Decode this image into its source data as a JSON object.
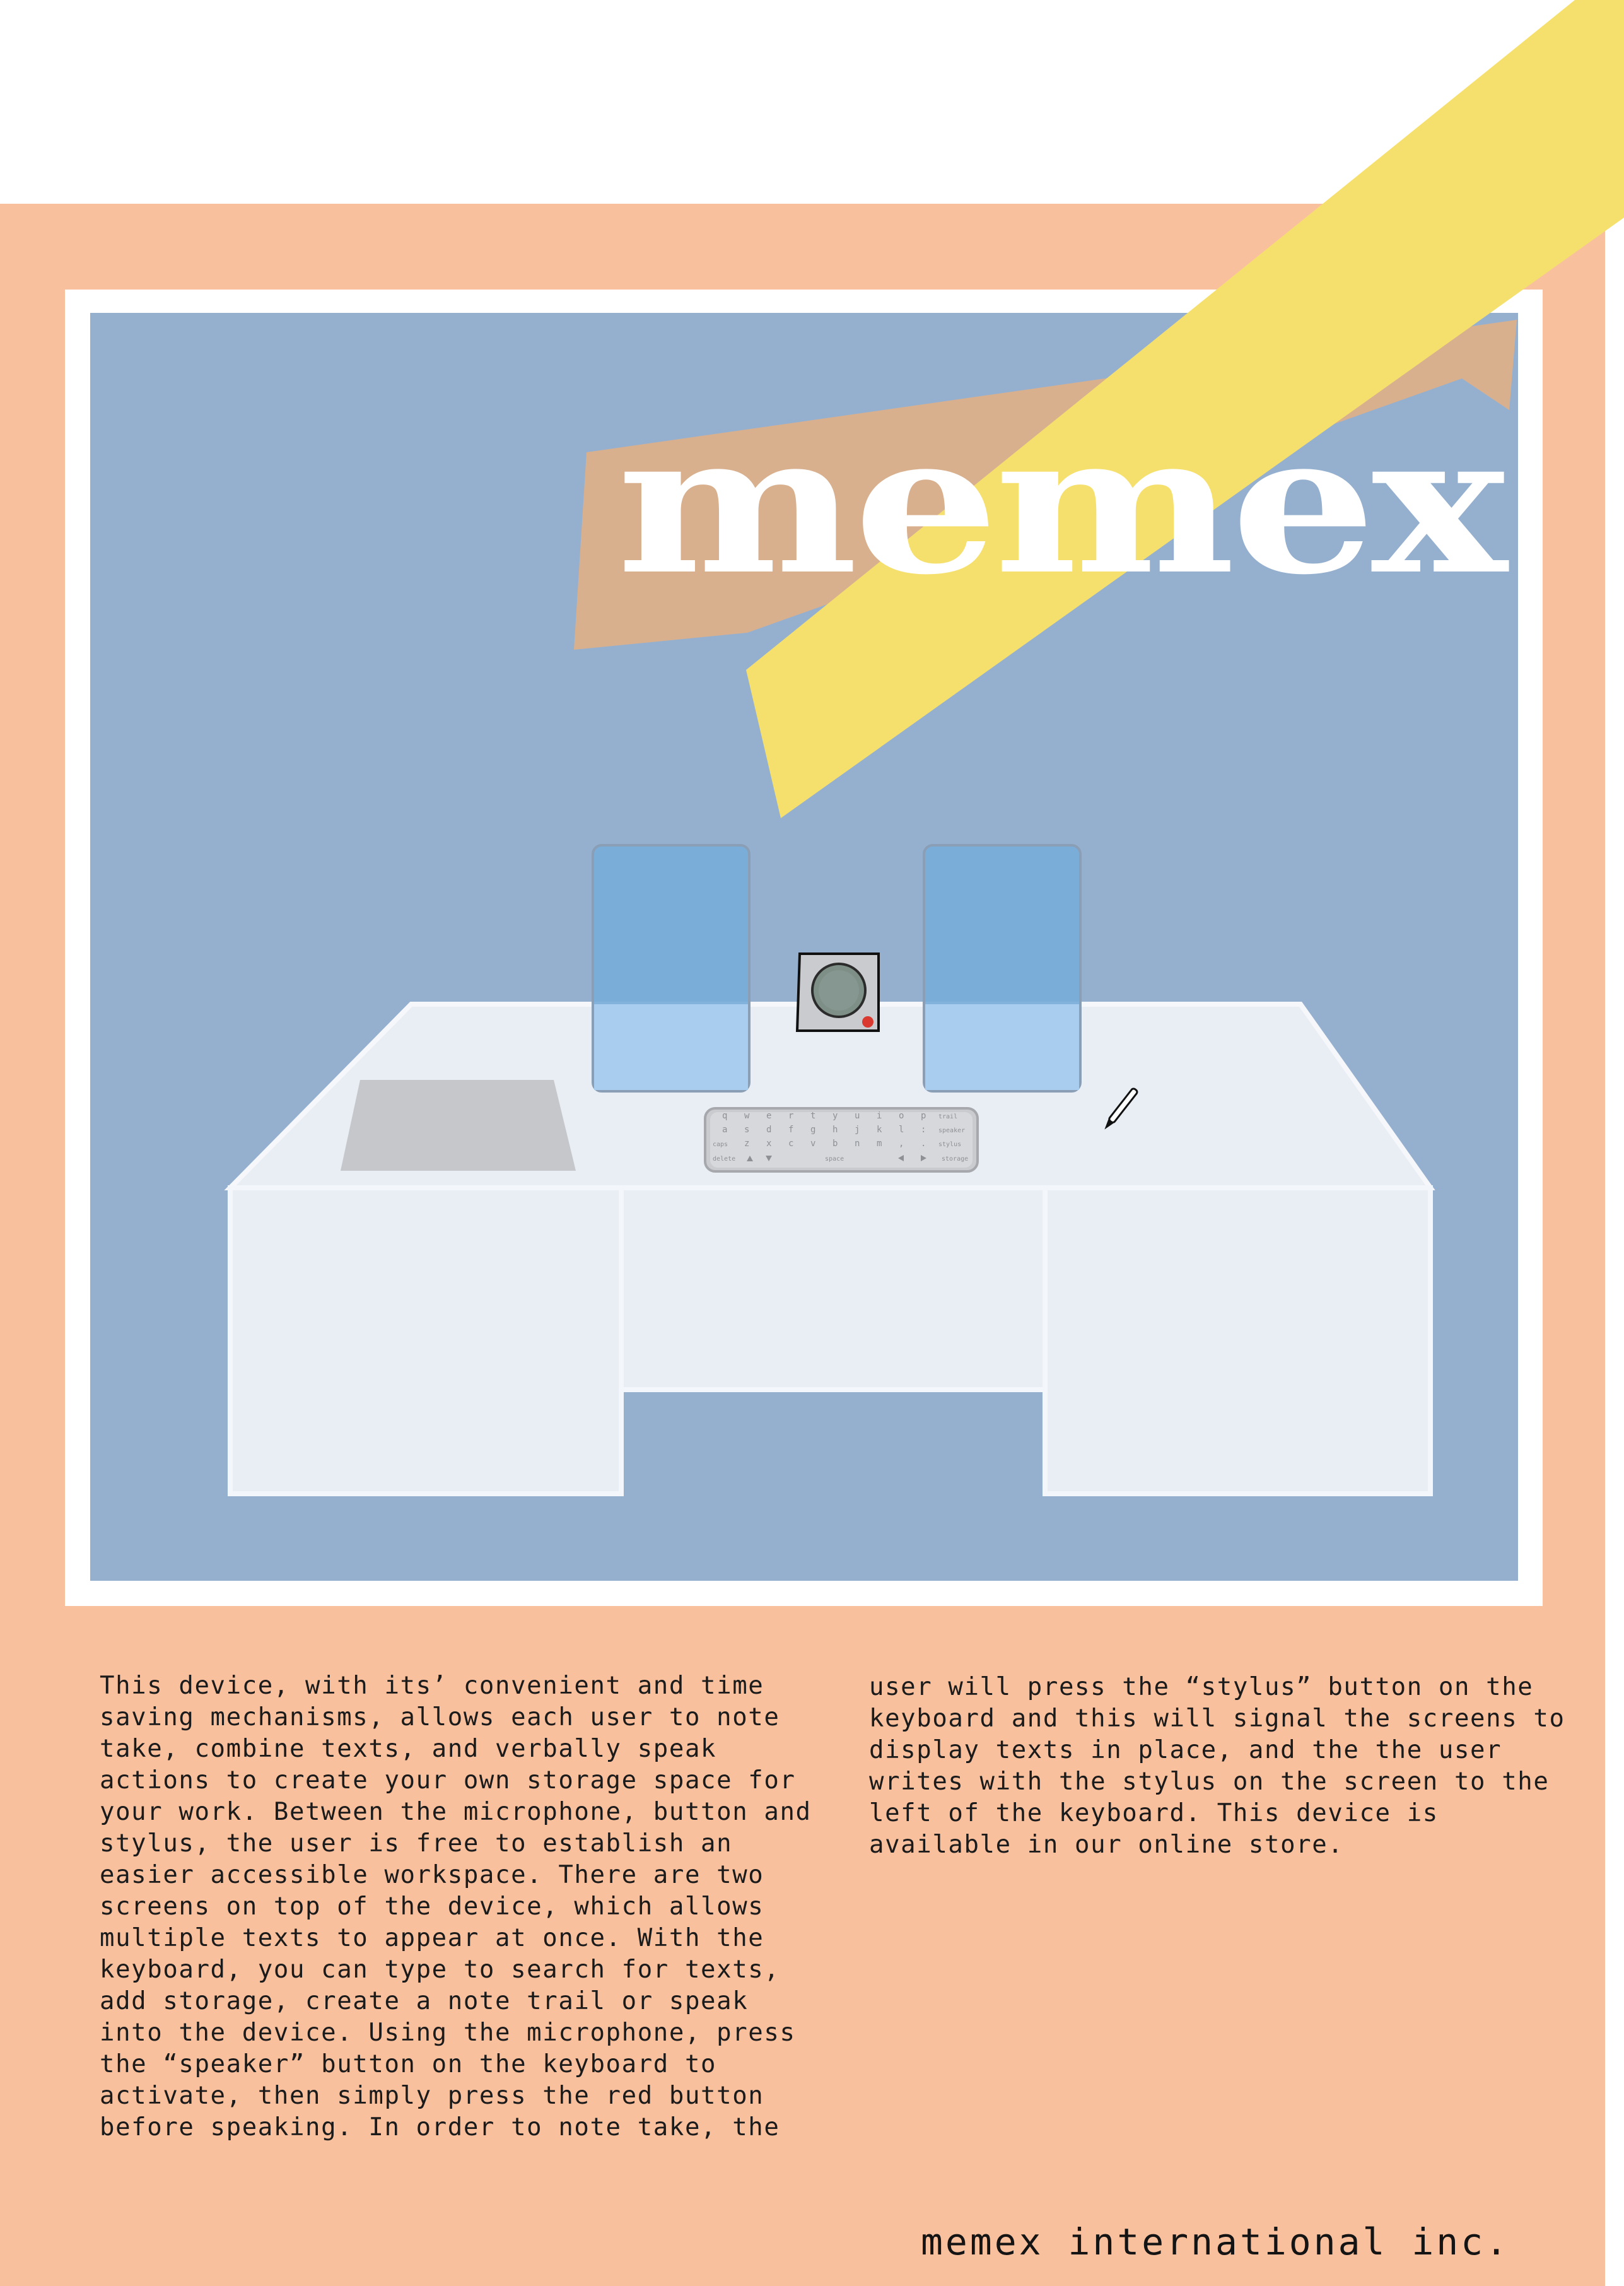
{
  "brand": {
    "title": "memex",
    "company": "memex international inc."
  },
  "colors": {
    "page_background": "#ffffff",
    "panel_peach": "#f9c09e",
    "illustration_blue": "#95b0cf",
    "ribbon_tan": "#d9b08e",
    "ribbon_yellow": "#f6e06d",
    "screen_blue": "#78adda",
    "desk_white": "#e9eef5"
  },
  "keyboard": {
    "row1": [
      "q",
      "w",
      "e",
      "r",
      "t",
      "y",
      "u",
      "i",
      "o",
      "p",
      "trail"
    ],
    "row2": [
      "a",
      "s",
      "d",
      "f",
      "g",
      "h",
      "j",
      "k",
      "l",
      ":",
      "speaker"
    ],
    "row3": [
      "caps",
      "z",
      "x",
      "c",
      "v",
      "b",
      "n",
      "m",
      ",",
      ".",
      "stylus"
    ],
    "row4": [
      "delete",
      "space",
      "storage"
    ]
  },
  "description": {
    "column_1": "This device, with its’ convenient and time saving mechanisms, allows each user to note take, combine texts, and verbally speak actions to create your own storage space for your work. Between the microphone, button and stylus, the user is free to establish an easier accessible workspace. There are two screens on top of the device, which allows multiple texts to appear at once. With the keyboard, you can type to search for texts, add storage, create a note trail or speak into the device. Using the microphone, press the “speaker” button on the keyboard to activate, then simply press the red button before speaking. In order to note take, the",
    "column_2": "user will press the “stylus” button on the keyboard and this will signal the screens to display texts in place, and the the user writes with the stylus on the screen to the left of the keyboard. This device is available in our online store."
  },
  "icons": {
    "microphone": "microphone-icon",
    "red_button": "red-button-icon",
    "stylus": "stylus-icon",
    "arrow_up": "arrow-up-icon",
    "arrow_down": "arrow-down-icon",
    "arrow_left": "arrow-left-icon",
    "arrow_right": "arrow-right-icon"
  }
}
